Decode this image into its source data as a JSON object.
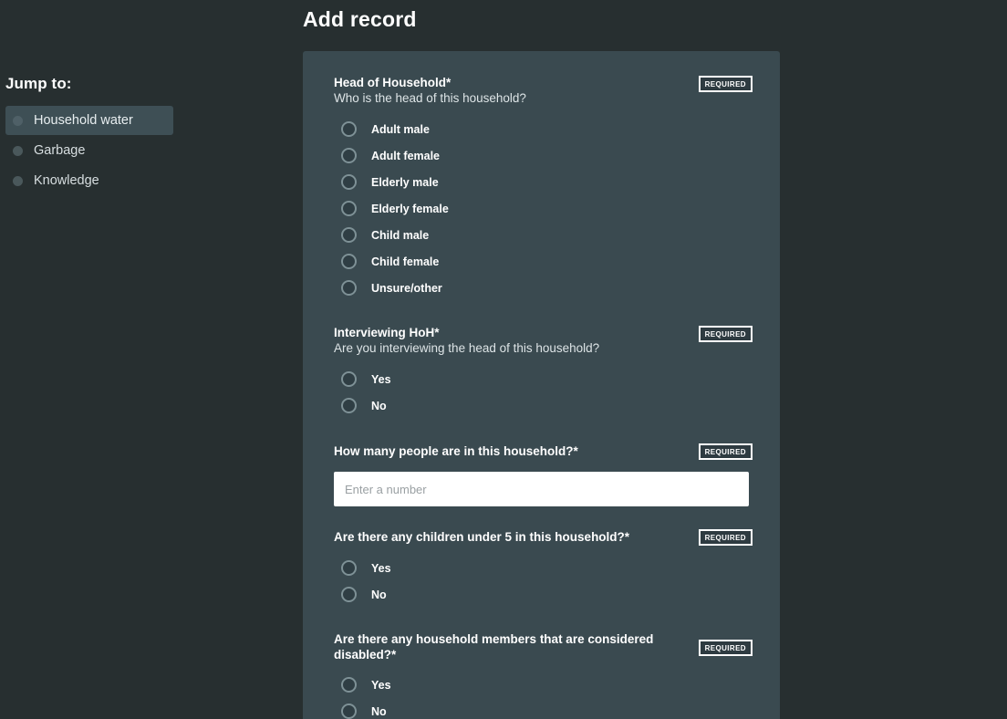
{
  "page": {
    "title": "Add record",
    "background_color": "#272f30",
    "card_color": "#3a4a50"
  },
  "sidebar": {
    "title": "Jump to:",
    "items": [
      {
        "label": "Household water",
        "active": true,
        "icon": "bullet-dot-icon"
      },
      {
        "label": "Garbage",
        "active": false,
        "icon": "bullet-dot-icon"
      },
      {
        "label": "Knowledge",
        "active": false,
        "icon": "bullet-dot-icon"
      }
    ]
  },
  "form": {
    "required_badge_label": "REQUIRED",
    "questions": [
      {
        "id": "head-of-household",
        "title": "Head of Household*",
        "subtitle": "Who is the head of this household?",
        "required": true,
        "type": "radio",
        "options": [
          "Adult male",
          "Adult female",
          "Elderly male",
          "Elderly female",
          "Child male",
          "Child female",
          "Unsure/other"
        ]
      },
      {
        "id": "interviewing-hoh",
        "title": "Interviewing HoH*",
        "subtitle": "Are you interviewing the head of this household?",
        "required": true,
        "type": "radio",
        "options": [
          "Yes",
          "No"
        ]
      },
      {
        "id": "household-size",
        "title": "How many people are in this household?*",
        "subtitle": "",
        "required": true,
        "type": "number",
        "value": "",
        "placeholder": "Enter a number"
      },
      {
        "id": "children-under-5",
        "title": "Are there any children under 5 in this household?*",
        "subtitle": "",
        "required": true,
        "type": "radio",
        "options": [
          "Yes",
          "No"
        ]
      },
      {
        "id": "disabled-members",
        "title": "Are there any household members that are considered disabled?*",
        "subtitle": "",
        "required": true,
        "type": "radio",
        "options": [
          "Yes",
          "No"
        ]
      }
    ]
  }
}
